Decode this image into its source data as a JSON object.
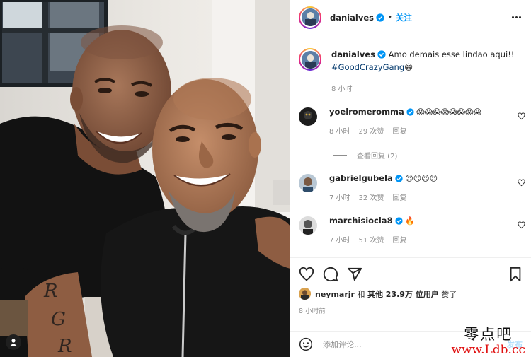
{
  "post": {
    "username": "danialves",
    "follow_label": "关注",
    "caption_text": "Amo demais esse lindao aqui!!",
    "hashtag": "#GoodCrazyGang",
    "caption_emoji": "😁",
    "caption_time": "8 小时"
  },
  "comments": [
    {
      "username": "yoelromeromma",
      "text": "😱😱😱😱😱😱😱😱",
      "time": "8 小时",
      "likes": "29 次赞",
      "reply_label": "回复",
      "view_replies": "查看回复 (2)"
    },
    {
      "username": "gabrielgubela",
      "text": "😍😍😍😍",
      "time": "7 小时",
      "likes": "32 次赞",
      "reply_label": "回复"
    },
    {
      "username": "marchisiocla8",
      "text": "🔥",
      "time": "7 小时",
      "likes": "51 次赞",
      "reply_label": "回复"
    }
  ],
  "likes": {
    "user": "neymarjr",
    "connector": " 和 ",
    "others": "其他 23.9万 位用户",
    "suffix": " 赞了"
  },
  "post_time": "8 小时前",
  "comment_input": {
    "placeholder": "添加评论..."
  },
  "post_button": "发布",
  "watermark": {
    "line1": "零点吧",
    "line2": "www.Ldb.cc"
  },
  "icons": {
    "heart": "heart-icon",
    "comment": "comment-icon",
    "share": "share-icon",
    "save": "bookmark-icon",
    "emoji": "emoji-icon",
    "more": "more-icon",
    "verified": "verified-icon",
    "user_tag": "user-tag-icon"
  },
  "colors": {
    "link": "#0095f6",
    "hashtag": "#00376b",
    "muted": "#8e8e8e",
    "verified": "#0095f6"
  }
}
